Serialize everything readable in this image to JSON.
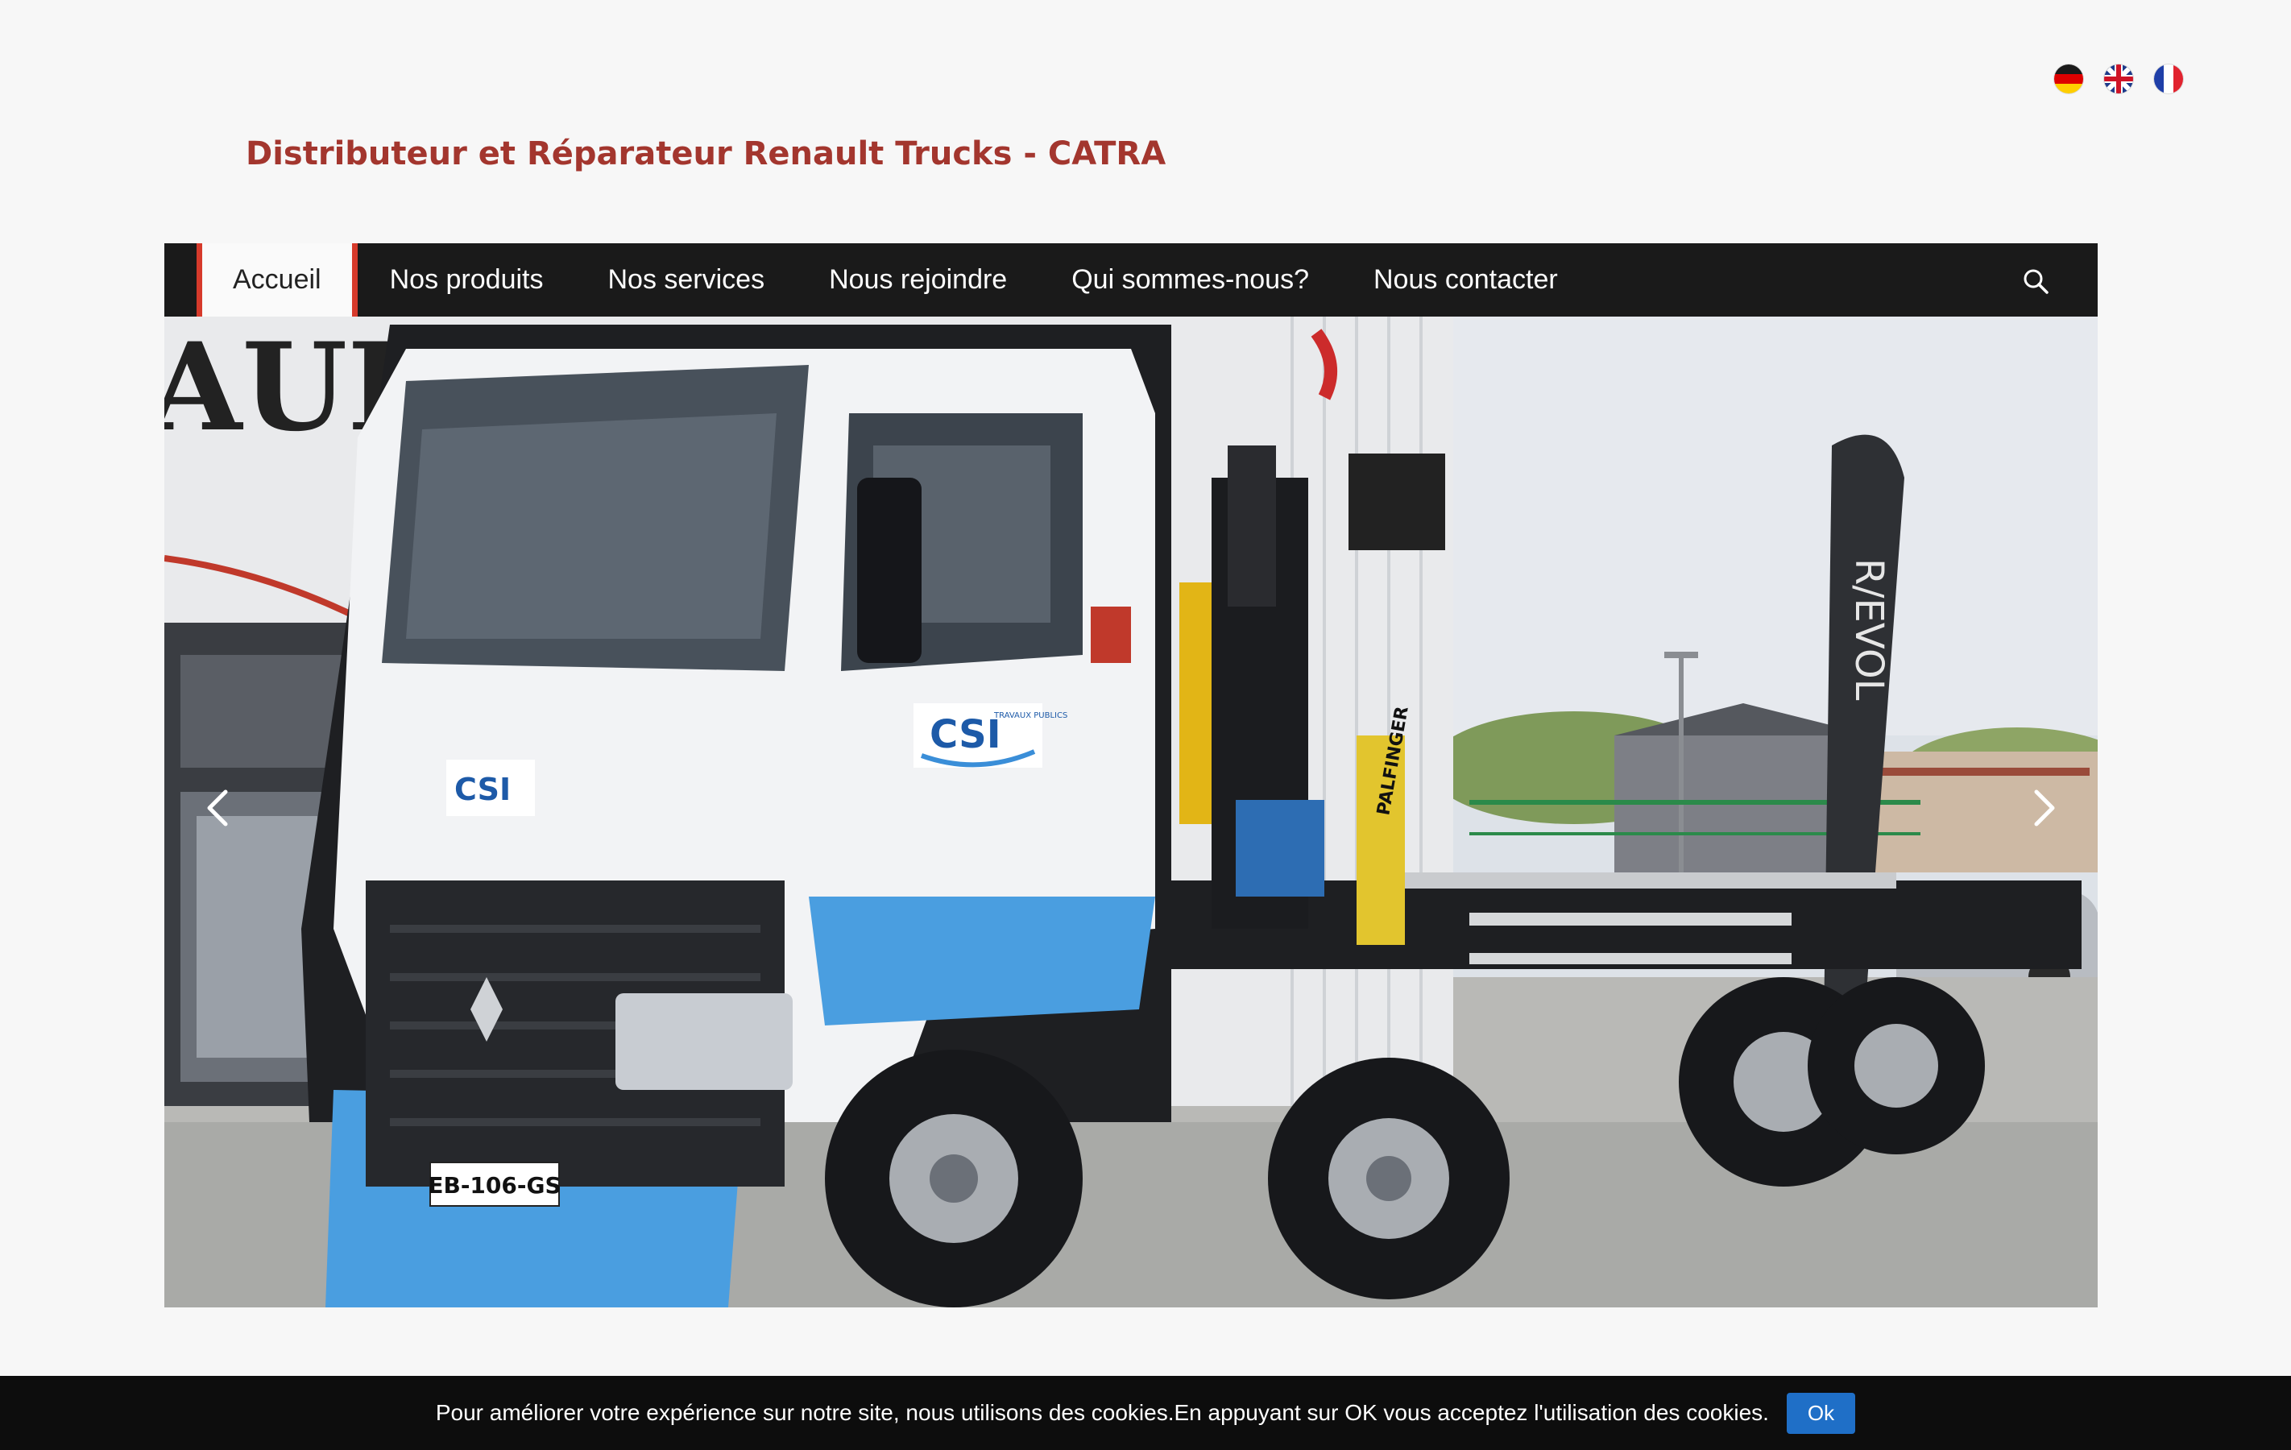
{
  "languages": [
    {
      "code": "de",
      "icon": "flag-germany-icon"
    },
    {
      "code": "en",
      "icon": "flag-uk-icon"
    },
    {
      "code": "fr",
      "icon": "flag-france-icon"
    }
  ],
  "header": {
    "title": "Distributeur et Réparateur Renault Trucks - CATRA"
  },
  "nav": {
    "items": [
      "Accueil",
      "Nos produits",
      "Nos services",
      "Nous rejoindre",
      "Qui sommes-nous?",
      "Nous contacter"
    ],
    "active_index": 0,
    "search_icon": "search-icon"
  },
  "slider": {
    "image_description_icon": "hero-image",
    "prev_icon": "chevron-left-icon",
    "next_icon": "chevron-right-icon",
    "plate": "EB-106-GS",
    "logo_text": "CSI",
    "logo_sub": "TRAVAUX PUBLICS",
    "crane_brand": "PALFINGER",
    "building_text": "AULT",
    "flag_banner_text": "R/EVOL"
  },
  "cookie": {
    "message": "Pour améliorer votre expérience sur notre site, nous utilisons des cookies.En appuyant sur OK vous acceptez l'utilisation des cookies.",
    "ok_label": "Ok"
  },
  "colors": {
    "title": "#a3362e",
    "nav_bg": "#1a1a1a",
    "nav_active_border": "#d63a2b",
    "cookie_button": "#1f6fc7"
  }
}
